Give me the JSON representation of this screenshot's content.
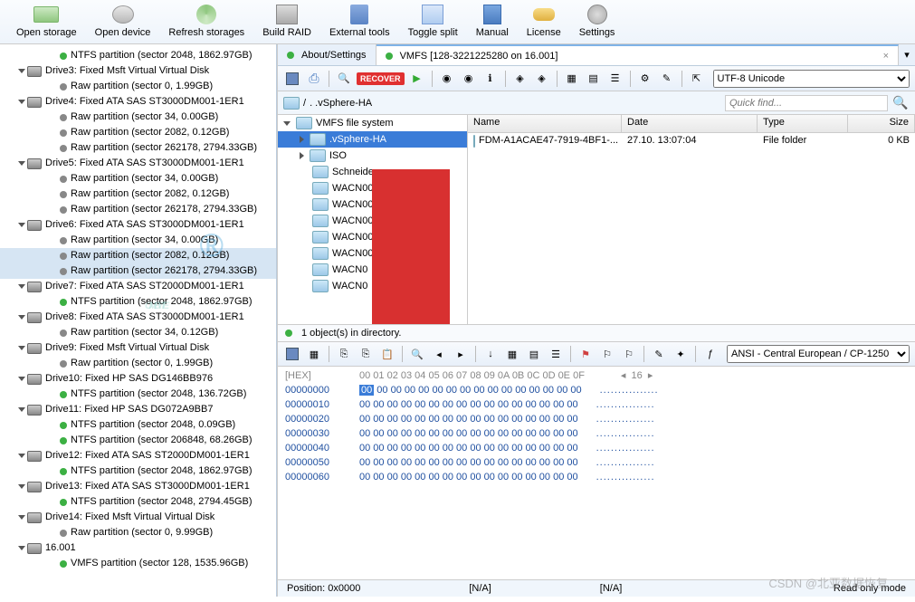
{
  "toolbar": [
    {
      "label": "Open storage",
      "icon": "folder"
    },
    {
      "label": "Open device",
      "icon": "disk"
    },
    {
      "label": "Refresh storages",
      "icon": "refresh"
    },
    {
      "label": "Build RAID",
      "icon": "raid"
    },
    {
      "label": "External tools",
      "icon": "tool"
    },
    {
      "label": "Toggle split",
      "icon": "split"
    },
    {
      "label": "Manual",
      "icon": "book"
    },
    {
      "label": "License",
      "icon": "key"
    },
    {
      "label": "Settings",
      "icon": "gear"
    }
  ],
  "left_tree": [
    {
      "ind": 3,
      "dot": "green",
      "text": "NTFS partition (sector 2048, 1862.97GB)"
    },
    {
      "ind": 1,
      "tri": "open",
      "hdd": true,
      "text": "Drive3: Fixed Msft Virtual Virtual Disk"
    },
    {
      "ind": 3,
      "dot": "gray",
      "text": "Raw partition (sector 0, 1.99GB)"
    },
    {
      "ind": 1,
      "tri": "open",
      "hdd": true,
      "text": "Drive4: Fixed ATA SAS ST3000DM001-1ER1"
    },
    {
      "ind": 3,
      "dot": "gray",
      "text": "Raw partition (sector 34, 0.00GB)"
    },
    {
      "ind": 3,
      "dot": "gray",
      "text": "Raw partition (sector 2082, 0.12GB)"
    },
    {
      "ind": 3,
      "dot": "gray",
      "text": "Raw partition (sector 262178, 2794.33GB)"
    },
    {
      "ind": 1,
      "tri": "open",
      "hdd": true,
      "text": "Drive5: Fixed ATA SAS ST3000DM001-1ER1"
    },
    {
      "ind": 3,
      "dot": "gray",
      "text": "Raw partition (sector 34, 0.00GB)"
    },
    {
      "ind": 3,
      "dot": "gray",
      "text": "Raw partition (sector 2082, 0.12GB)"
    },
    {
      "ind": 3,
      "dot": "gray",
      "text": "Raw partition (sector 262178, 2794.33GB)"
    },
    {
      "ind": 1,
      "tri": "open",
      "hdd": true,
      "text": "Drive6: Fixed ATA SAS ST3000DM001-1ER1"
    },
    {
      "ind": 3,
      "dot": "gray",
      "text": "Raw partition (sector 34, 0.00GB)"
    },
    {
      "ind": 3,
      "dot": "gray",
      "text": "Raw partition (sector 2082, 0.12GB)",
      "sel": true
    },
    {
      "ind": 3,
      "dot": "gray",
      "text": "Raw partition (sector 262178, 2794.33GB)",
      "sel": true
    },
    {
      "ind": 1,
      "tri": "open",
      "hdd": true,
      "text": "Drive7: Fixed ATA SAS ST2000DM001-1ER1"
    },
    {
      "ind": 3,
      "dot": "green",
      "text": "NTFS partition (sector 2048, 1862.97GB)"
    },
    {
      "ind": 1,
      "tri": "open",
      "hdd": true,
      "text": "Drive8: Fixed ATA SAS ST3000DM001-1ER1"
    },
    {
      "ind": 3,
      "dot": "gray",
      "text": "Raw partition (sector 34, 0.12GB)"
    },
    {
      "ind": 1,
      "tri": "open",
      "hdd": true,
      "text": "Drive9: Fixed Msft Virtual Virtual Disk"
    },
    {
      "ind": 3,
      "dot": "gray",
      "text": "Raw partition (sector 0, 1.99GB)"
    },
    {
      "ind": 1,
      "tri": "open",
      "hdd": true,
      "text": "Drive10: Fixed HP SAS DG146BB976"
    },
    {
      "ind": 3,
      "dot": "green",
      "text": "NTFS partition (sector 2048, 136.72GB)"
    },
    {
      "ind": 1,
      "tri": "open",
      "hdd": true,
      "text": "Drive11: Fixed HP SAS DG072A9BB7"
    },
    {
      "ind": 3,
      "dot": "green",
      "text": "NTFS partition (sector 2048, 0.09GB)"
    },
    {
      "ind": 3,
      "dot": "green",
      "text": "NTFS partition (sector 206848, 68.26GB)"
    },
    {
      "ind": 1,
      "tri": "open",
      "hdd": true,
      "text": "Drive12: Fixed ATA SAS ST2000DM001-1ER1"
    },
    {
      "ind": 3,
      "dot": "green",
      "text": "NTFS partition (sector 2048, 1862.97GB)"
    },
    {
      "ind": 1,
      "tri": "open",
      "hdd": true,
      "text": "Drive13: Fixed ATA SAS ST3000DM001-1ER1"
    },
    {
      "ind": 3,
      "dot": "green",
      "text": "NTFS partition (sector 2048, 2794.45GB)"
    },
    {
      "ind": 1,
      "tri": "open",
      "hdd": true,
      "text": "Drive14: Fixed Msft Virtual Virtual Disk"
    },
    {
      "ind": 3,
      "dot": "gray",
      "text": "Raw partition (sector 0, 9.99GB)"
    },
    {
      "ind": 1,
      "tri": "open",
      "hdd": true,
      "text": "16.001"
    },
    {
      "ind": 3,
      "dot": "green",
      "text": "VMFS partition (sector 128, 1535.96GB)"
    }
  ],
  "tabs": {
    "about": "About/Settings",
    "vmfs": "VMFS [128-3221225280 on 16.001]"
  },
  "encoding": "UTF-8 Unicode",
  "path": ". .vSphere-HA",
  "quick_find": "Quick find...",
  "fs_tree": [
    {
      "ind": 0,
      "tri": "open",
      "text": "VMFS file system"
    },
    {
      "ind": 1,
      "tri": "closed",
      "text": ".vSphere-HA",
      "sel": true
    },
    {
      "ind": 1,
      "tri": "closed",
      "text": "ISO"
    },
    {
      "ind": 1,
      "text": "Schneide"
    },
    {
      "ind": 1,
      "text": "WACN00"
    },
    {
      "ind": 1,
      "text": "WACN00                   01"
    },
    {
      "ind": 1,
      "text": "WACN00                  02"
    },
    {
      "ind": 1,
      "text": "WACN00"
    },
    {
      "ind": 1,
      "text": "WACN00"
    },
    {
      "ind": 1,
      "text": "WACN0"
    },
    {
      "ind": 1,
      "text": "WACN0"
    }
  ],
  "file_cols": {
    "name": "Name",
    "date": "Date",
    "type": "Type",
    "size": "Size"
  },
  "file_rows": [
    {
      "name": "FDM-A1ACAE47-7919-4BF1-...",
      "date": "27.10.         13:07:04",
      "type": "File folder",
      "size": "0 KB"
    }
  ],
  "status": "1 object(s) in directory.",
  "hex_encoding": "ANSI - Central European / CP-1250",
  "hex": {
    "header": "[HEX]",
    "cols": "00 01 02 03 04 05 06 07 08 09 0A 0B 0C 0D 0E 0F",
    "width": "16",
    "offsets": [
      "00000000",
      "00000010",
      "00000020",
      "00000030",
      "00000040",
      "00000050",
      "00000060"
    ],
    "bytes": "00 00 00 00 00 00 00 00 00 00 00 00 00 00 00 00",
    "ascii": "................"
  },
  "bottom": {
    "pos": "Position: 0x0000",
    "na1": "[N/A]",
    "na2": "[N/A]",
    "mode": "Read only mode"
  },
  "watermark": "OMBYTE",
  "reg": "®",
  "csdn": "CSDN @北亚数据恢复"
}
